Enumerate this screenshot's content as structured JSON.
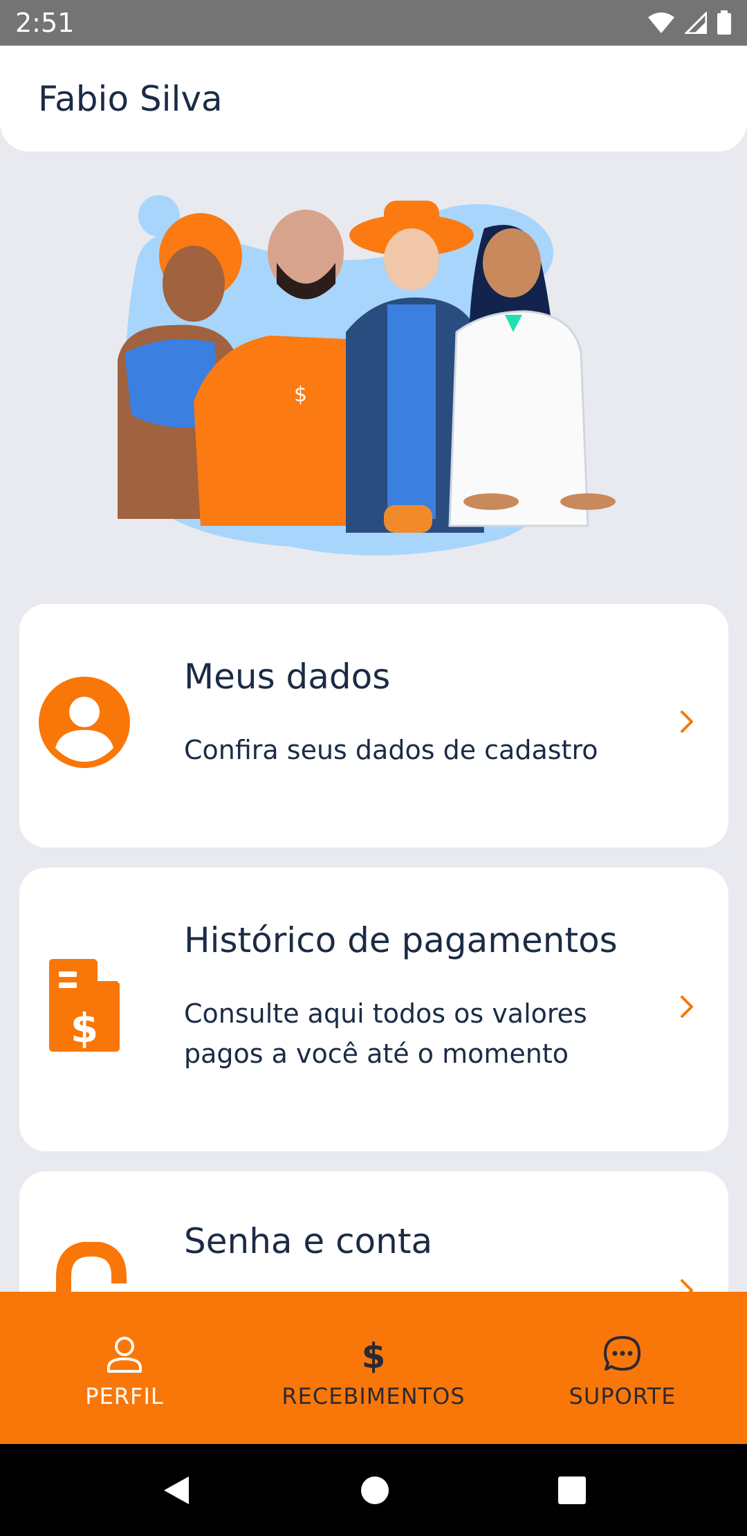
{
  "status_bar": {
    "time": "2:51"
  },
  "header": {
    "user_name": "Fabio Silva"
  },
  "cards": [
    {
      "title": "Meus dados",
      "description": "Confira seus dados de cadastro",
      "icon": "user-circle-icon"
    },
    {
      "title": "Histórico de pagamentos",
      "description": "Consulte aqui todos os valores pagos a você até o momento",
      "icon": "payment-document-icon"
    },
    {
      "title": "Senha e conta",
      "description": "",
      "icon": "unlock-icon"
    }
  ],
  "bottom_nav": [
    {
      "label": "PERFIL",
      "icon": "person-icon",
      "active": true
    },
    {
      "label": "RECEBIMENTOS",
      "icon": "dollar-icon",
      "active": false
    },
    {
      "label": "SUPORTE",
      "icon": "chat-bubble-icon",
      "active": false
    }
  ],
  "colors": {
    "accent": "#f97708",
    "text": "#1b2b45",
    "background": "#e8eaef"
  }
}
